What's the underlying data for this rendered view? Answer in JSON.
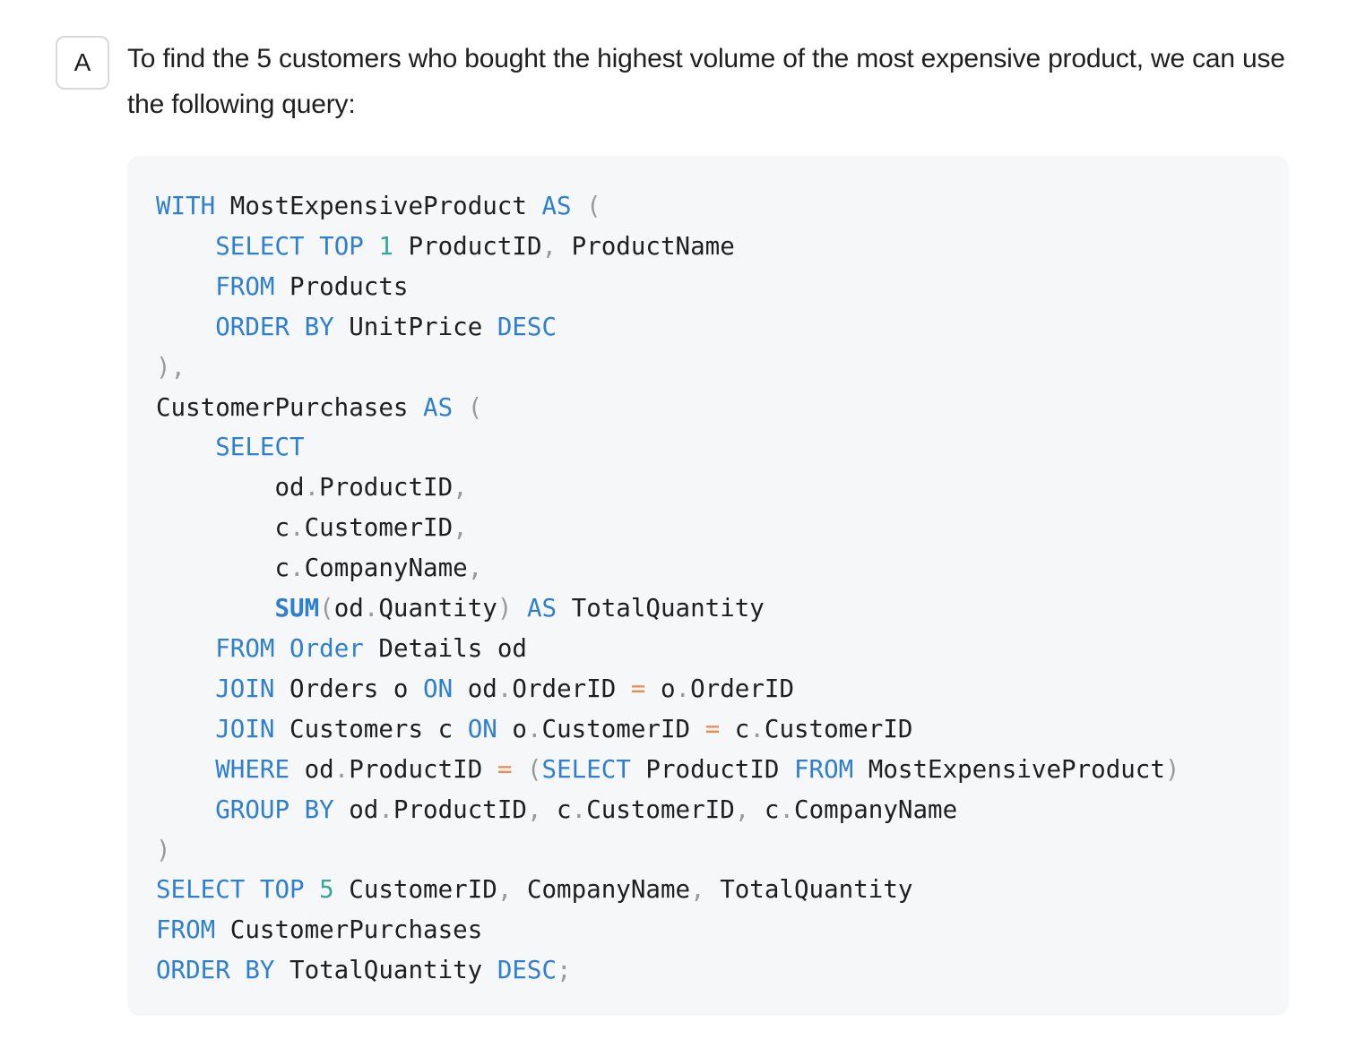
{
  "avatar": {
    "label": "A"
  },
  "message": {
    "intro": "To find the 5 customers who bought the highest volume of the most expensive product, we can use the following query:"
  },
  "code": {
    "language": "sql",
    "colors": {
      "keyword": "#2f7fd1",
      "number": "#3aa39b",
      "operator": "#f08a4b",
      "punctuation": "#9a9a9a",
      "identifier": "#1f1f1f",
      "background": "#f6f7f9"
    },
    "lines": [
      [
        {
          "t": "kw",
          "v": "WITH"
        },
        {
          "t": "id",
          "v": " MostExpensiveProduct "
        },
        {
          "t": "kw",
          "v": "AS"
        },
        {
          "t": "id",
          "v": " "
        },
        {
          "t": "p",
          "v": "("
        }
      ],
      [
        {
          "t": "id",
          "v": "    "
        },
        {
          "t": "kw",
          "v": "SELECT"
        },
        {
          "t": "id",
          "v": " "
        },
        {
          "t": "kw",
          "v": "TOP"
        },
        {
          "t": "id",
          "v": " "
        },
        {
          "t": "num",
          "v": "1"
        },
        {
          "t": "id",
          "v": " ProductID"
        },
        {
          "t": "p",
          "v": ","
        },
        {
          "t": "id",
          "v": " ProductName"
        }
      ],
      [
        {
          "t": "id",
          "v": "    "
        },
        {
          "t": "kw",
          "v": "FROM"
        },
        {
          "t": "id",
          "v": " Products"
        }
      ],
      [
        {
          "t": "id",
          "v": "    "
        },
        {
          "t": "kw",
          "v": "ORDER BY"
        },
        {
          "t": "id",
          "v": " UnitPrice "
        },
        {
          "t": "kw",
          "v": "DESC"
        }
      ],
      [
        {
          "t": "p",
          "v": "),"
        }
      ],
      [
        {
          "t": "id",
          "v": "CustomerPurchases "
        },
        {
          "t": "kw",
          "v": "AS"
        },
        {
          "t": "id",
          "v": " "
        },
        {
          "t": "p",
          "v": "("
        }
      ],
      [
        {
          "t": "id",
          "v": "    "
        },
        {
          "t": "kw",
          "v": "SELECT"
        }
      ],
      [
        {
          "t": "id",
          "v": "        od"
        },
        {
          "t": "p",
          "v": "."
        },
        {
          "t": "id",
          "v": "ProductID"
        },
        {
          "t": "p",
          "v": ","
        }
      ],
      [
        {
          "t": "id",
          "v": "        c"
        },
        {
          "t": "p",
          "v": "."
        },
        {
          "t": "id",
          "v": "CustomerID"
        },
        {
          "t": "p",
          "v": ","
        }
      ],
      [
        {
          "t": "id",
          "v": "        c"
        },
        {
          "t": "p",
          "v": "."
        },
        {
          "t": "id",
          "v": "CompanyName"
        },
        {
          "t": "p",
          "v": ","
        }
      ],
      [
        {
          "t": "id",
          "v": "        "
        },
        {
          "t": "kwb",
          "v": "SUM"
        },
        {
          "t": "p",
          "v": "("
        },
        {
          "t": "id",
          "v": "od"
        },
        {
          "t": "p",
          "v": "."
        },
        {
          "t": "id",
          "v": "Quantity"
        },
        {
          "t": "p",
          "v": ")"
        },
        {
          "t": "id",
          "v": " "
        },
        {
          "t": "kw",
          "v": "AS"
        },
        {
          "t": "id",
          "v": " TotalQuantity"
        }
      ],
      [
        {
          "t": "id",
          "v": "    "
        },
        {
          "t": "kw",
          "v": "FROM"
        },
        {
          "t": "id",
          "v": " "
        },
        {
          "t": "kw",
          "v": "Order"
        },
        {
          "t": "id",
          "v": " Details od"
        }
      ],
      [
        {
          "t": "id",
          "v": "    "
        },
        {
          "t": "kw",
          "v": "JOIN"
        },
        {
          "t": "id",
          "v": " Orders o "
        },
        {
          "t": "kw",
          "v": "ON"
        },
        {
          "t": "id",
          "v": " od"
        },
        {
          "t": "p",
          "v": "."
        },
        {
          "t": "id",
          "v": "OrderID "
        },
        {
          "t": "op",
          "v": "="
        },
        {
          "t": "id",
          "v": " o"
        },
        {
          "t": "p",
          "v": "."
        },
        {
          "t": "id",
          "v": "OrderID"
        }
      ],
      [
        {
          "t": "id",
          "v": "    "
        },
        {
          "t": "kw",
          "v": "JOIN"
        },
        {
          "t": "id",
          "v": " Customers c "
        },
        {
          "t": "kw",
          "v": "ON"
        },
        {
          "t": "id",
          "v": " o"
        },
        {
          "t": "p",
          "v": "."
        },
        {
          "t": "id",
          "v": "CustomerID "
        },
        {
          "t": "op",
          "v": "="
        },
        {
          "t": "id",
          "v": " c"
        },
        {
          "t": "p",
          "v": "."
        },
        {
          "t": "id",
          "v": "CustomerID"
        }
      ],
      [
        {
          "t": "id",
          "v": "    "
        },
        {
          "t": "kw",
          "v": "WHERE"
        },
        {
          "t": "id",
          "v": " od"
        },
        {
          "t": "p",
          "v": "."
        },
        {
          "t": "id",
          "v": "ProductID "
        },
        {
          "t": "op",
          "v": "="
        },
        {
          "t": "id",
          "v": " "
        },
        {
          "t": "p",
          "v": "("
        },
        {
          "t": "kw",
          "v": "SELECT"
        },
        {
          "t": "id",
          "v": " ProductID "
        },
        {
          "t": "kw",
          "v": "FROM"
        },
        {
          "t": "id",
          "v": " MostExpensiveProduct"
        },
        {
          "t": "p",
          "v": ")"
        }
      ],
      [
        {
          "t": "id",
          "v": "    "
        },
        {
          "t": "kw",
          "v": "GROUP BY"
        },
        {
          "t": "id",
          "v": " od"
        },
        {
          "t": "p",
          "v": "."
        },
        {
          "t": "id",
          "v": "ProductID"
        },
        {
          "t": "p",
          "v": ","
        },
        {
          "t": "id",
          "v": " c"
        },
        {
          "t": "p",
          "v": "."
        },
        {
          "t": "id",
          "v": "CustomerID"
        },
        {
          "t": "p",
          "v": ","
        },
        {
          "t": "id",
          "v": " c"
        },
        {
          "t": "p",
          "v": "."
        },
        {
          "t": "id",
          "v": "CompanyName"
        }
      ],
      [
        {
          "t": "p",
          "v": ")"
        }
      ],
      [
        {
          "t": "kw",
          "v": "SELECT"
        },
        {
          "t": "id",
          "v": " "
        },
        {
          "t": "kw",
          "v": "TOP"
        },
        {
          "t": "id",
          "v": " "
        },
        {
          "t": "num",
          "v": "5"
        },
        {
          "t": "id",
          "v": " CustomerID"
        },
        {
          "t": "p",
          "v": ","
        },
        {
          "t": "id",
          "v": " CompanyName"
        },
        {
          "t": "p",
          "v": ","
        },
        {
          "t": "id",
          "v": " TotalQuantity"
        }
      ],
      [
        {
          "t": "kw",
          "v": "FROM"
        },
        {
          "t": "id",
          "v": " CustomerPurchases"
        }
      ],
      [
        {
          "t": "kw",
          "v": "ORDER BY"
        },
        {
          "t": "id",
          "v": " TotalQuantity "
        },
        {
          "t": "kw",
          "v": "DESC"
        },
        {
          "t": "p",
          "v": ";"
        }
      ]
    ]
  }
}
